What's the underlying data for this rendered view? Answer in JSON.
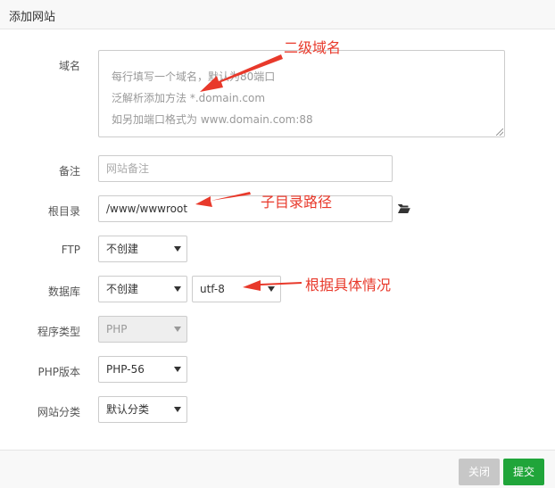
{
  "window": {
    "title": "添加网站"
  },
  "form": {
    "domain": {
      "label": "域名",
      "placeholder_lines": [
        "每行填写一个域名，默认为80端口",
        "泛解析添加方法 *.domain.com",
        "如另加端口格式为 www.domain.com:88"
      ]
    },
    "note": {
      "label": "备注",
      "placeholder": "网站备注"
    },
    "root": {
      "label": "根目录",
      "value": "/www/wwwroot",
      "icon": "folder-open-icon"
    },
    "ftp": {
      "label": "FTP",
      "selected": "不创建"
    },
    "database": {
      "label": "数据库",
      "selected": "不创建",
      "charset": "utf-8"
    },
    "program_type": {
      "label": "程序类型",
      "selected": "PHP"
    },
    "php_version": {
      "label": "PHP版本",
      "selected": "PHP-56"
    },
    "category": {
      "label": "网站分类",
      "selected": "默认分类"
    }
  },
  "footer": {
    "close_label": "关闭",
    "submit_label": "提交"
  },
  "annotations": {
    "domain_note": "二级域名",
    "root_note": "子目录路径",
    "charset_note": "根据具体情况"
  },
  "colors": {
    "accent": "#20a53a",
    "annotation": "#e8392b",
    "disabled": "#c7c7c7"
  }
}
